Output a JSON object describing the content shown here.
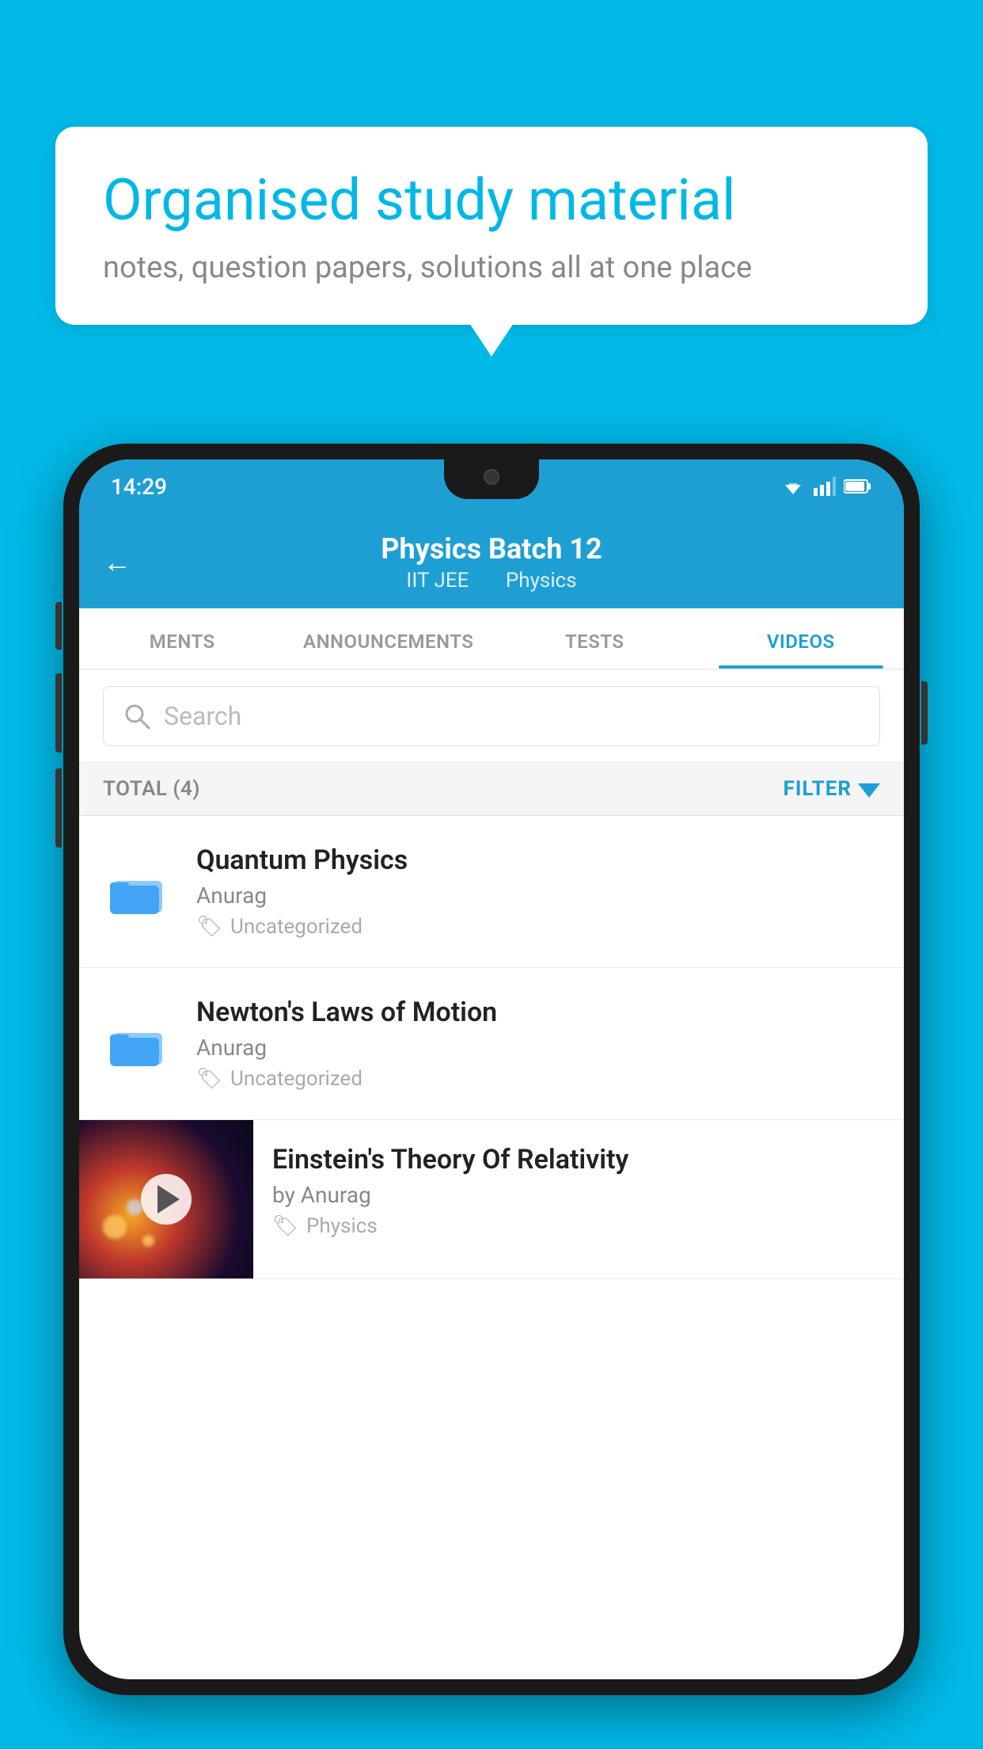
{
  "background_color": "#00b8e6",
  "speech_bubble": {
    "title": "Organised study material",
    "subtitle": "notes, question papers, solutions all at one place"
  },
  "status_bar": {
    "time": "14:29",
    "color": "#1e9fd4"
  },
  "app_header": {
    "title": "Physics Batch 12",
    "subtitle_left": "IIT JEE",
    "subtitle_right": "Physics",
    "back_label": "←"
  },
  "tabs": [
    {
      "label": "MENTS",
      "active": false
    },
    {
      "label": "ANNOUNCEMENTS",
      "active": false
    },
    {
      "label": "TESTS",
      "active": false
    },
    {
      "label": "VIDEOS",
      "active": true
    }
  ],
  "search": {
    "placeholder": "Search"
  },
  "filter_bar": {
    "total_label": "TOTAL (4)",
    "filter_label": "FILTER"
  },
  "video_items": [
    {
      "title": "Quantum Physics",
      "author": "Anurag",
      "tag": "Uncategorized",
      "type": "folder"
    },
    {
      "title": "Newton's Laws of Motion",
      "author": "Anurag",
      "tag": "Uncategorized",
      "type": "folder"
    },
    {
      "title": "Einstein's Theory Of Relativity",
      "author": "by Anurag",
      "tag": "Physics",
      "type": "video"
    }
  ]
}
